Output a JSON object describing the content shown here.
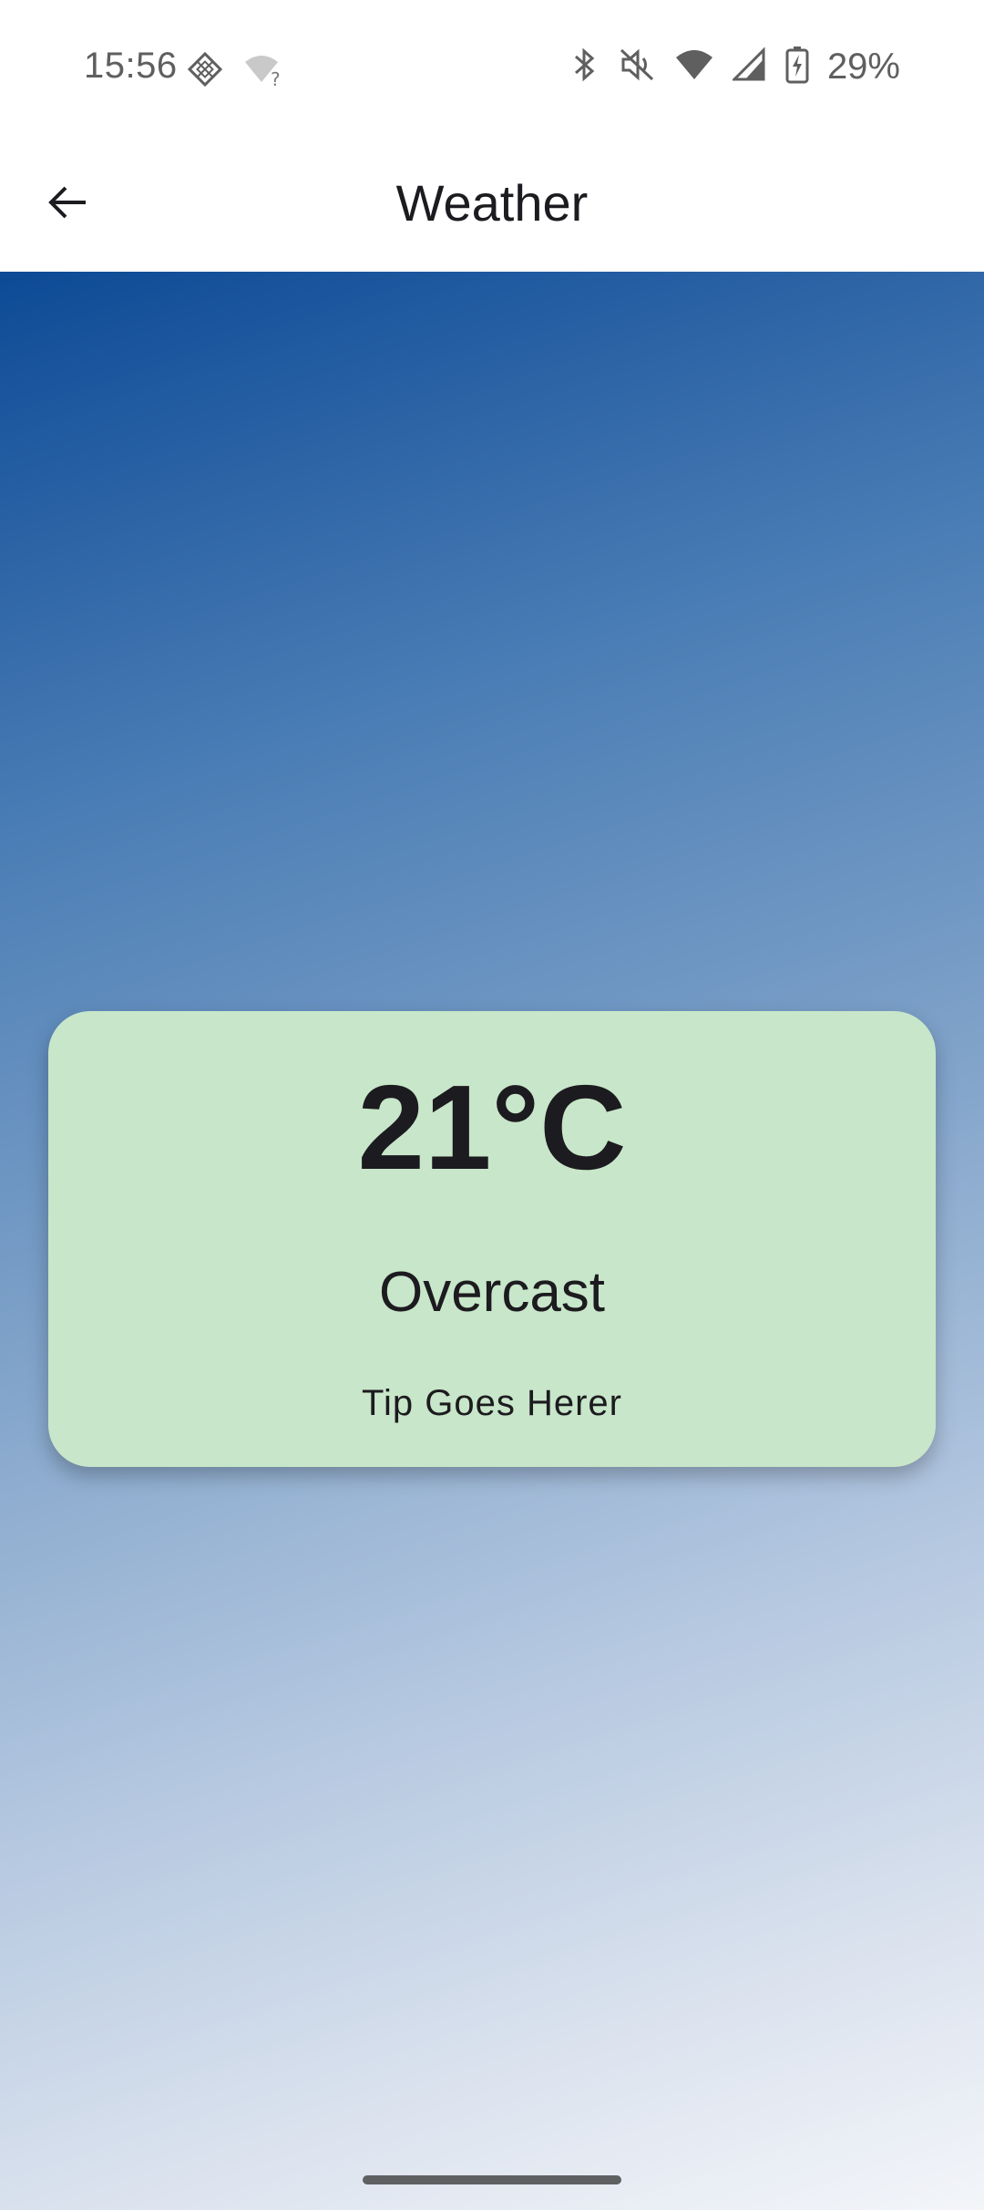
{
  "status_bar": {
    "time": "15:56",
    "battery": "29%",
    "icons": [
      "sim-diamond-icon",
      "wifi-unknown-icon",
      "bluetooth-icon",
      "mute-icon",
      "wifi-icon",
      "signal-icon",
      "battery-charging-icon"
    ]
  },
  "app_bar": {
    "title": "Weather",
    "back_icon": "back-arrow-icon"
  },
  "weather": {
    "temperature": "21°C",
    "condition": "Overcast",
    "tip": "Tip Goes Herer"
  },
  "colors": {
    "card_background": "#c8e6c9",
    "gradient_top": "#0d4a96",
    "gradient_bottom": "#f3f5f9"
  }
}
